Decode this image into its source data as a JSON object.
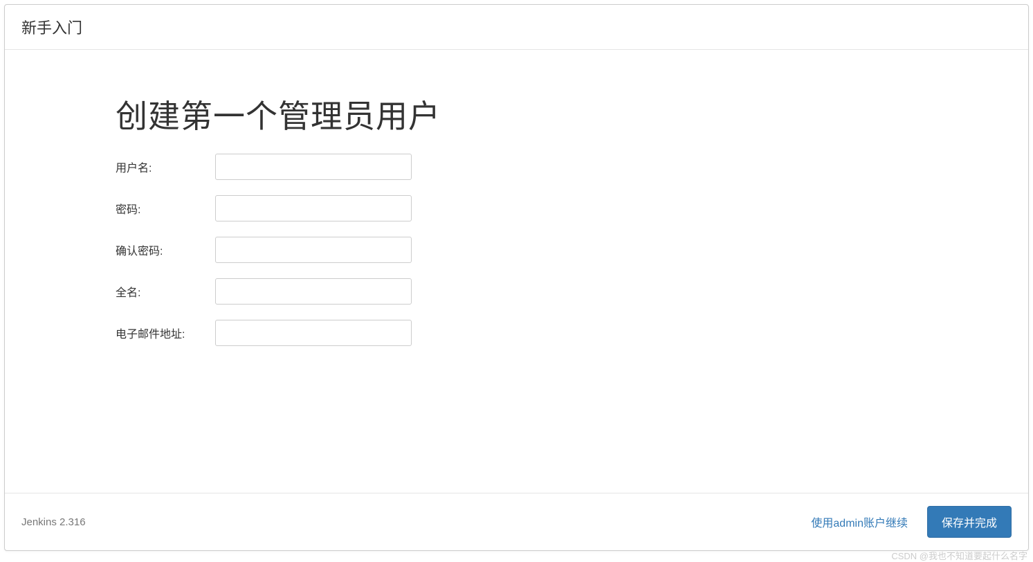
{
  "header": {
    "title": "新手入门"
  },
  "main": {
    "title": "创建第一个管理员用户",
    "fields": {
      "username": {
        "label": "用户名:",
        "value": ""
      },
      "password": {
        "label": "密码:",
        "value": ""
      },
      "confirm_password": {
        "label": "确认密码:",
        "value": ""
      },
      "fullname": {
        "label": "全名:",
        "value": ""
      },
      "email": {
        "label": "电子邮件地址:",
        "value": ""
      }
    }
  },
  "footer": {
    "version": "Jenkins 2.316",
    "skip_label": "使用admin账户继续",
    "save_label": "保存并完成"
  },
  "watermark": "CSDN @我也不知道要起什么名字"
}
